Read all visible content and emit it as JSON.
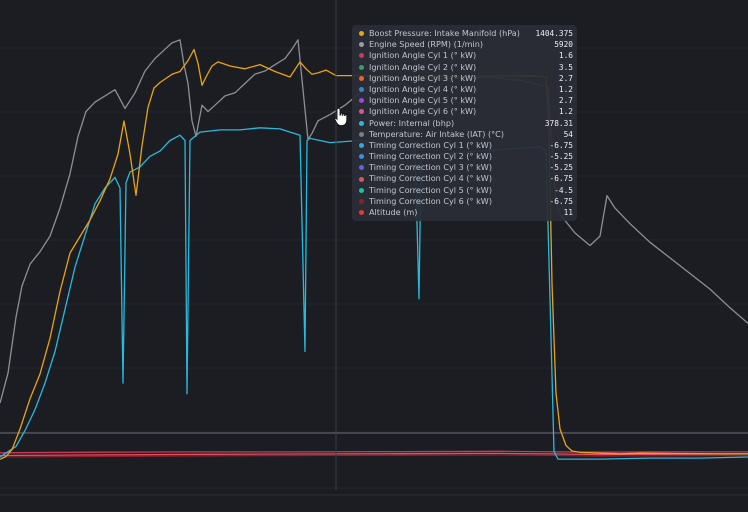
{
  "chart_data": {
    "type": "line",
    "title": "",
    "xlabel": "",
    "ylabel": "",
    "grid": true,
    "series": [
      {
        "name": "Engine Speed (RPM) (1/min)",
        "color": "#8e8e99",
        "x": [
          0,
          8,
          16,
          22,
          30,
          40,
          50,
          60,
          70,
          78,
          86,
          95,
          105,
          115,
          125,
          135,
          145,
          155,
          165,
          172,
          180,
          184,
          188,
          192,
          196,
          202,
          208,
          215,
          225,
          235,
          245,
          255,
          265,
          275,
          285,
          292,
          298,
          303,
          308,
          312,
          318,
          330,
          345,
          360,
          380,
          400,
          430,
          460,
          490,
          520,
          548,
          553,
          556,
          560,
          575,
          590,
          600,
          607,
          615,
          630,
          650,
          670,
          690,
          710,
          730,
          748
        ],
        "y": [
          720,
          1200,
          2100,
          2600,
          2950,
          3150,
          3400,
          3850,
          4400,
          5000,
          5400,
          5550,
          5650,
          5750,
          5450,
          5700,
          6050,
          6250,
          6400,
          6500,
          6550,
          6150,
          5850,
          5250,
          5000,
          5500,
          5400,
          5500,
          5650,
          5700,
          5850,
          6000,
          6050,
          6150,
          6250,
          6400,
          6550,
          5750,
          4950,
          5050,
          5250,
          5350,
          5500,
          5700,
          5900,
          5930,
          5920,
          5930,
          5950,
          5900,
          5800,
          4650,
          3950,
          3750,
          3450,
          3250,
          3400,
          4050,
          3850,
          3600,
          3300,
          3050,
          2800,
          2550,
          2250,
          2000
        ]
      },
      {
        "name": "Boost Pressure: Intake Manifold (hPa)",
        "color": "#e8a317",
        "x": [
          0,
          6,
          12,
          20,
          30,
          40,
          50,
          60,
          70,
          80,
          90,
          100,
          110,
          118,
          124,
          130,
          136,
          142,
          148,
          154,
          160,
          166,
          172,
          180,
          188,
          194,
          198,
          202,
          206,
          212,
          218,
          230,
          245,
          260,
          275,
          290,
          300,
          306,
          312,
          318,
          326,
          336,
          344,
          352,
          360,
          400,
          450,
          500,
          540,
          546,
          549,
          552,
          556,
          560,
          566,
          572,
          580,
          600,
          620,
          640,
          680,
          720,
          748
        ],
        "y": [
          10,
          20,
          45,
          120,
          230,
          320,
          450,
          620,
          760,
          820,
          880,
          950,
          1030,
          1120,
          1240,
          1120,
          970,
          1150,
          1290,
          1360,
          1380,
          1395,
          1410,
          1420,
          1460,
          1500,
          1450,
          1370,
          1400,
          1440,
          1455,
          1440,
          1430,
          1445,
          1420,
          1400,
          1455,
          1430,
          1410,
          1415,
          1425,
          1405,
          1405,
          1405,
          1405,
          1400,
          1402,
          1404,
          1403,
          1400,
          1200,
          650,
          250,
          120,
          60,
          40,
          35,
          32,
          30,
          32,
          31,
          30,
          30
        ]
      },
      {
        "name": "Power: Internal (bhp)",
        "color": "#2bb8dc",
        "x": [
          0,
          8,
          16,
          25,
          35,
          45,
          55,
          65,
          75,
          85,
          95,
          105,
          115,
          120,
          123,
          126,
          130,
          140,
          150,
          160,
          170,
          180,
          185,
          187,
          190,
          200,
          220,
          240,
          260,
          280,
          300,
          305,
          307,
          310,
          330,
          360,
          390,
          415,
          419,
          421,
          425,
          450,
          480,
          510,
          540,
          546,
          550,
          554,
          558,
          600,
          650,
          700,
          748
        ],
        "y": [
          0,
          5,
          10,
          25,
          45,
          70,
          100,
          140,
          180,
          210,
          240,
          255,
          265,
          255,
          70,
          260,
          270,
          275,
          285,
          290,
          300,
          305,
          300,
          60,
          300,
          308,
          310,
          310,
          312,
          311,
          305,
          100,
          300,
          302,
          298,
          300,
          296,
          294,
          150,
          280,
          285,
          288,
          290,
          292,
          294,
          290,
          150,
          5,
          -2,
          -2,
          -1,
          -1,
          0
        ]
      },
      {
        "name": "Temperature: Air Intake (IAT) (°C)",
        "color": "#6b6d76",
        "x": [
          0,
          748
        ],
        "y": [
          54,
          54
        ]
      },
      {
        "name": "Timing Correction Cyl 4 (° kW)",
        "color": "#e2525e",
        "x": [
          0,
          100,
          200,
          300,
          400,
          500,
          560,
          600,
          650,
          748
        ],
        "y": [
          15,
          17,
          19,
          20,
          21,
          22,
          20,
          18,
          19,
          20
        ]
      },
      {
        "name": "Timing Correction Cyl 6 (° kW)",
        "color": "#8e1f2a",
        "x": [
          0,
          100,
          200,
          300,
          400,
          500,
          560,
          600,
          650,
          748
        ],
        "y": [
          10,
          12,
          14,
          15,
          16,
          17,
          15,
          13,
          14,
          15
        ]
      },
      {
        "name": "Ignition Angle Cyl 1 (° kW)",
        "color": "#c9395d",
        "x": [
          0,
          100,
          200,
          300,
          400,
          500,
          560,
          600,
          650,
          748
        ],
        "y": [
          24,
          26,
          27,
          27,
          28,
          29,
          27,
          26,
          27,
          27
        ]
      }
    ]
  },
  "tooltip": {
    "rows": [
      {
        "label": "Boost Pressure: Intake Manifold (hPa)",
        "value": "1404.375",
        "color": "#e8a317"
      },
      {
        "label": "Engine Speed (RPM) (1/min)",
        "value": "5920",
        "color": "#9a9aa3"
      },
      {
        "label": "Ignition Angle Cyl 1 (° kW)",
        "value": "1.6",
        "color": "#c9395d"
      },
      {
        "label": "Ignition Angle Cyl 2 (° kW)",
        "value": "3.5",
        "color": "#2fa36b"
      },
      {
        "label": "Ignition Angle Cyl 3 (° kW)",
        "value": "2.7",
        "color": "#e06c2c"
      },
      {
        "label": "Ignition Angle Cyl 4 (° kW)",
        "value": "1.2",
        "color": "#3a86c8"
      },
      {
        "label": "Ignition Angle Cyl 5 (° kW)",
        "value": "2.7",
        "color": "#9a48d6"
      },
      {
        "label": "Ignition Angle Cyl 6 (° kW)",
        "value": "1.2",
        "color": "#e0559a"
      },
      {
        "label": "Power: Internal (bhp)",
        "value": "378.31",
        "color": "#2bb8dc"
      },
      {
        "label": "Temperature: Air Intake (IAT) (°C)",
        "value": "54",
        "color": "#7b7d86"
      },
      {
        "label": "Timing Correction Cyl 1 (° kW)",
        "value": "-6.75",
        "color": "#2fa9e0"
      },
      {
        "label": "Timing Correction Cyl 2 (° kW)",
        "value": "-5.25",
        "color": "#3d8fe0"
      },
      {
        "label": "Timing Correction Cyl 3 (° kW)",
        "value": "-5.25",
        "color": "#6166e0"
      },
      {
        "label": "Timing Correction Cyl 4 (° kW)",
        "value": "-6.75",
        "color": "#e2525e"
      },
      {
        "label": "Timing Correction Cyl 5 (° kW)",
        "value": "-4.5",
        "color": "#1fbfb0"
      },
      {
        "label": "Timing Correction Cyl 6 (° kW)",
        "value": "-6.75",
        "color": "#8e1f2a"
      },
      {
        "label": "Altitude (m)",
        "value": "11",
        "color": "#e23c3c"
      }
    ]
  }
}
